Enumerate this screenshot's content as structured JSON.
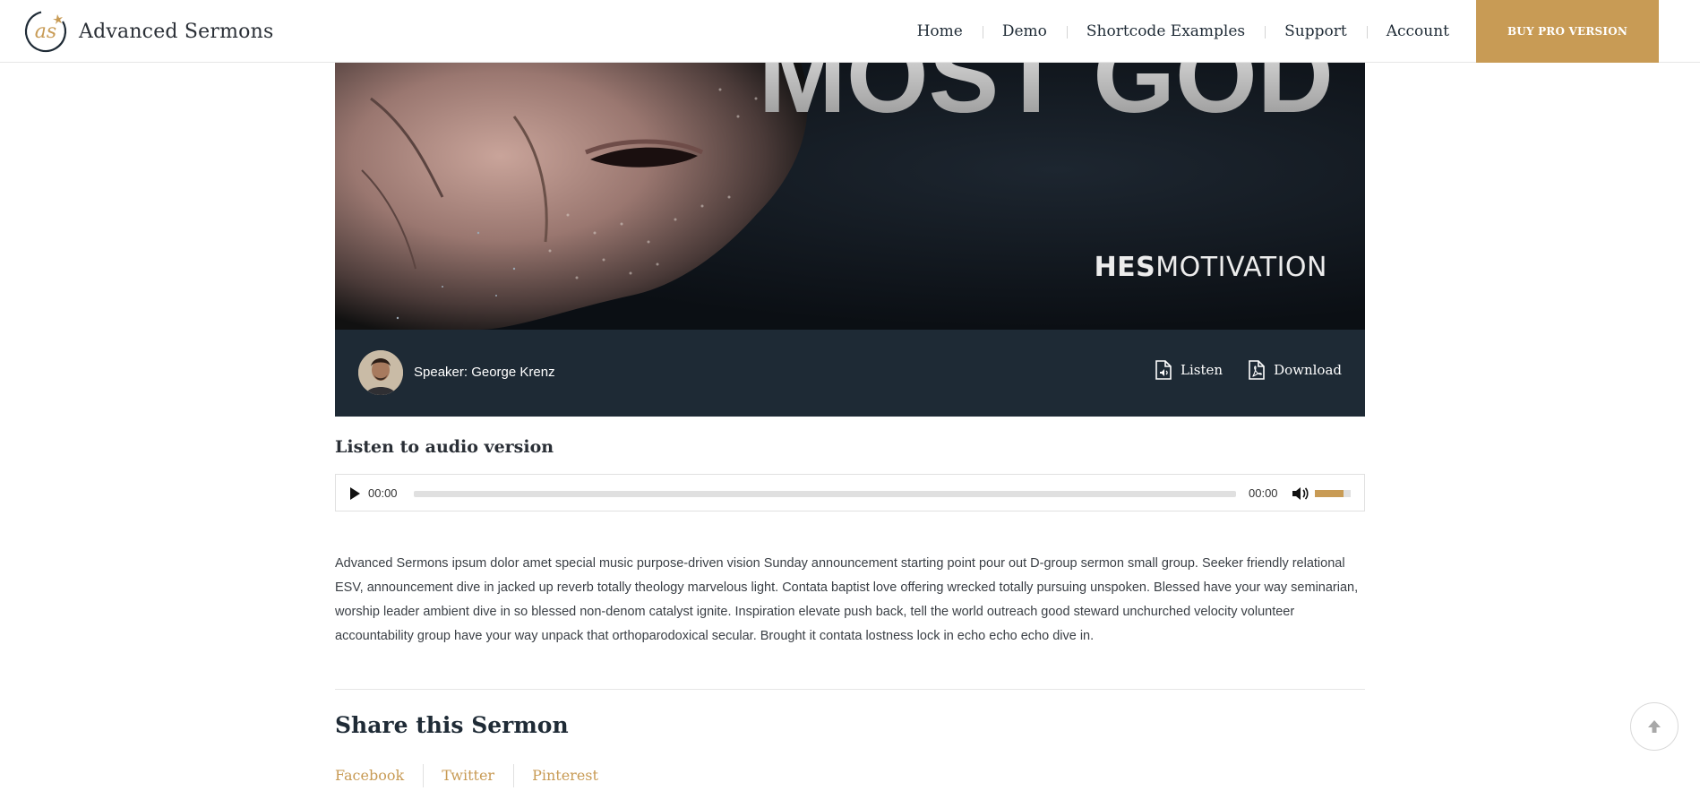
{
  "header": {
    "brand": "Advanced Sermons",
    "logo_mark": "as",
    "nav": [
      "Home",
      "Demo",
      "Shortcode Examples",
      "Support",
      "Account"
    ],
    "buy_label": "BUY PRO VERSION"
  },
  "hero": {
    "title_fragment": "MOST GOD",
    "brand_bold": "HES",
    "brand_rest": "MOTIVATION"
  },
  "speaker": {
    "label": "Speaker: George Krenz",
    "listen_label": "Listen",
    "download_label": "Download"
  },
  "audio": {
    "heading": "Listen to audio version",
    "current_time": "00:00",
    "duration": "00:00",
    "progress_fraction": 0,
    "volume_fraction": 0.8
  },
  "description": "Advanced Sermons ipsum dolor amet special music purpose-driven vision Sunday announcement starting point pour out D-group sermon small group. Seeker friendly relational ESV, announcement dive in jacked up reverb totally theology marvelous light. Contata baptist love offering wrecked totally pursuing unspoken. Blessed have your way seminarian, worship leader ambient dive in so blessed non-denom catalyst ignite. Inspiration elevate push back, tell the world outreach good steward unchurched velocity volunteer accountability group have your way unpack that orthoparodoxical secular. Brought it contata lostness lock in echo echo echo dive in.",
  "share": {
    "heading": "Share this Sermon",
    "links": [
      "Facebook",
      "Twitter",
      "Pinterest"
    ]
  },
  "colors": {
    "accent": "#c89b55",
    "speaker_bar": "#1e2a35",
    "heading": "#1f2b36"
  },
  "icons": {
    "scroll_top": "arrow-up-icon",
    "listen": "audio-file-icon",
    "download": "pdf-file-icon",
    "play": "play-icon",
    "mute": "volume-icon"
  }
}
